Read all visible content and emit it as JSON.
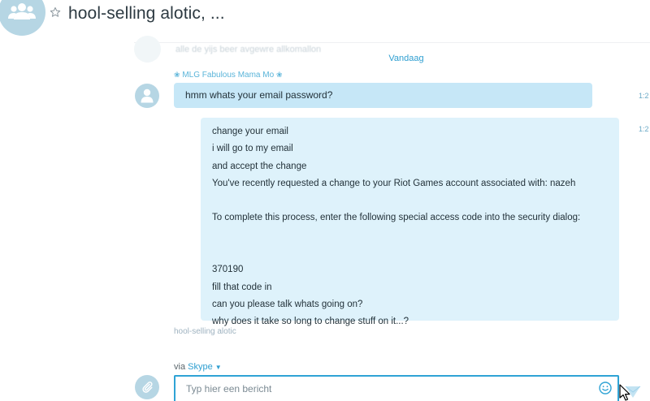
{
  "header": {
    "title": "hool-selling alotic, ..."
  },
  "faded_top": {
    "text": "alle de yijs beer avgewre allkomallon"
  },
  "date_separator": "Vandaag",
  "message1": {
    "sender": "MLG Fabulous Mama Mo",
    "text": "hmm whats your email password?",
    "time": "1:2"
  },
  "message2": {
    "time": "1:2",
    "lines": [
      "change your email",
      "i will go to my email",
      "and accept the change",
      "You've recently requested a change to your Riot Games account associated with: nazeh",
      "",
      "To complete this process, enter the following special access code into the security dialog:",
      "",
      "",
      "370190",
      "fill that code in",
      "can you please talk whats going on?",
      "why does it take so long to change stuff on it...?"
    ]
  },
  "faded_name": "hool-selling alotic",
  "composer": {
    "via_label": "via",
    "service": "Skype",
    "placeholder": "Typ hier een bericht"
  },
  "colors": {
    "accent": "#2fa3d5",
    "bubble_incoming": "#c6e7f7",
    "bubble_outgoing": "#def2fb",
    "avatar_bg": "#b6d6e4"
  },
  "icons": {
    "group_avatar": "group-people-icon",
    "favorite": "star-outline-icon",
    "user_avatar": "person-icon",
    "attach": "paperclip-icon",
    "emoticon": "smiley-icon",
    "send": "send-arrow-icon",
    "cursor": "mouse-pointer-icon"
  }
}
